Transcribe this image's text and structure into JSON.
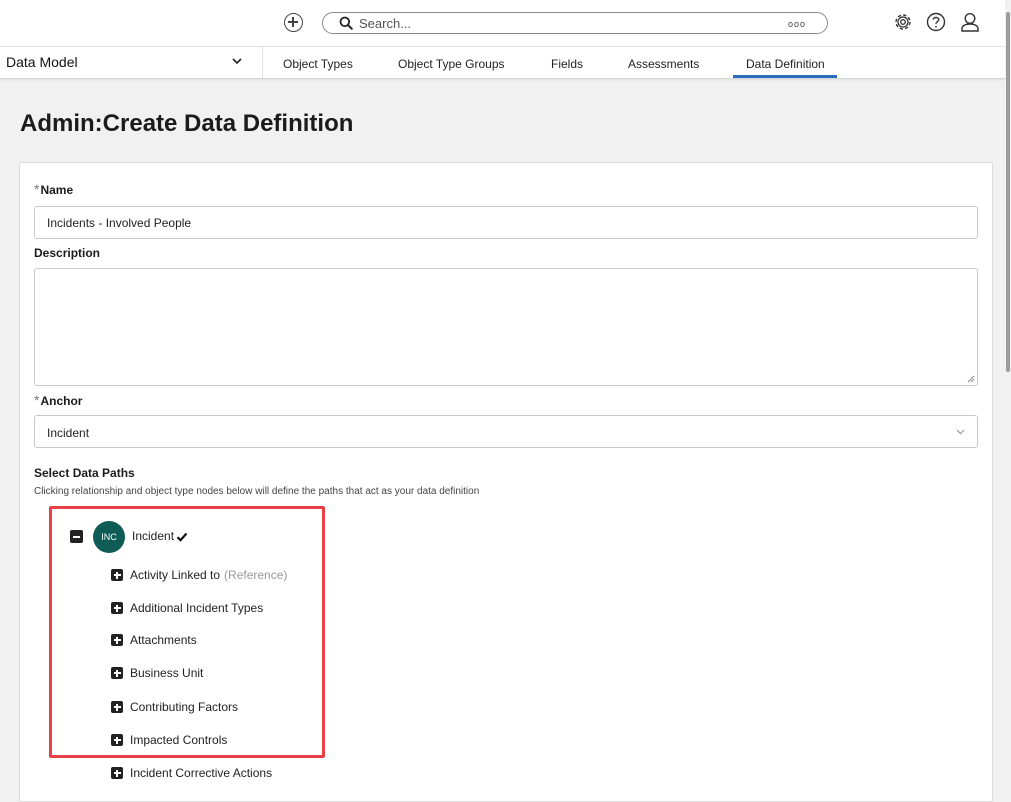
{
  "topbar": {
    "add_icon": "plus-circle-icon",
    "search_placeholder": "Search...",
    "search_more": "ooo",
    "icons": [
      "gear-icon",
      "help-icon",
      "user-icon"
    ]
  },
  "nav": {
    "dropdown_label": "Data Model",
    "tabs": [
      {
        "label": "Object Types"
      },
      {
        "label": "Object Type Groups"
      },
      {
        "label": "Fields"
      },
      {
        "label": "Assessments"
      },
      {
        "label": "Data Definition",
        "active": true
      }
    ]
  },
  "page": {
    "title_prefix": "Admin",
    "title_sep": ":",
    "title_main": "Create Data Definition"
  },
  "form": {
    "required_marker": "*",
    "name_label": "Name",
    "name_value": "Incidents - Involved People",
    "description_label": "Description",
    "description_value": "",
    "anchor_label": "Anchor",
    "anchor_value": "Incident",
    "paths_label": "Select Data Paths",
    "paths_helper": "Clicking relationship and object type nodes below will define the paths that act as your data definition"
  },
  "tree": {
    "root": {
      "badge": "INC",
      "label": "Incident"
    },
    "items": [
      {
        "label": "Activity Linked to",
        "note": "(Reference)"
      },
      {
        "label": "Additional Incident Types"
      },
      {
        "label": "Attachments"
      },
      {
        "label": "Business Unit"
      },
      {
        "label": "Contributing Factors"
      },
      {
        "label": "Impacted Controls"
      },
      {
        "label": "Incident Corrective Actions"
      }
    ]
  },
  "colors": {
    "accent": "#2b6dbf",
    "badge": "#0f5c56",
    "highlight": "#e8414a"
  }
}
